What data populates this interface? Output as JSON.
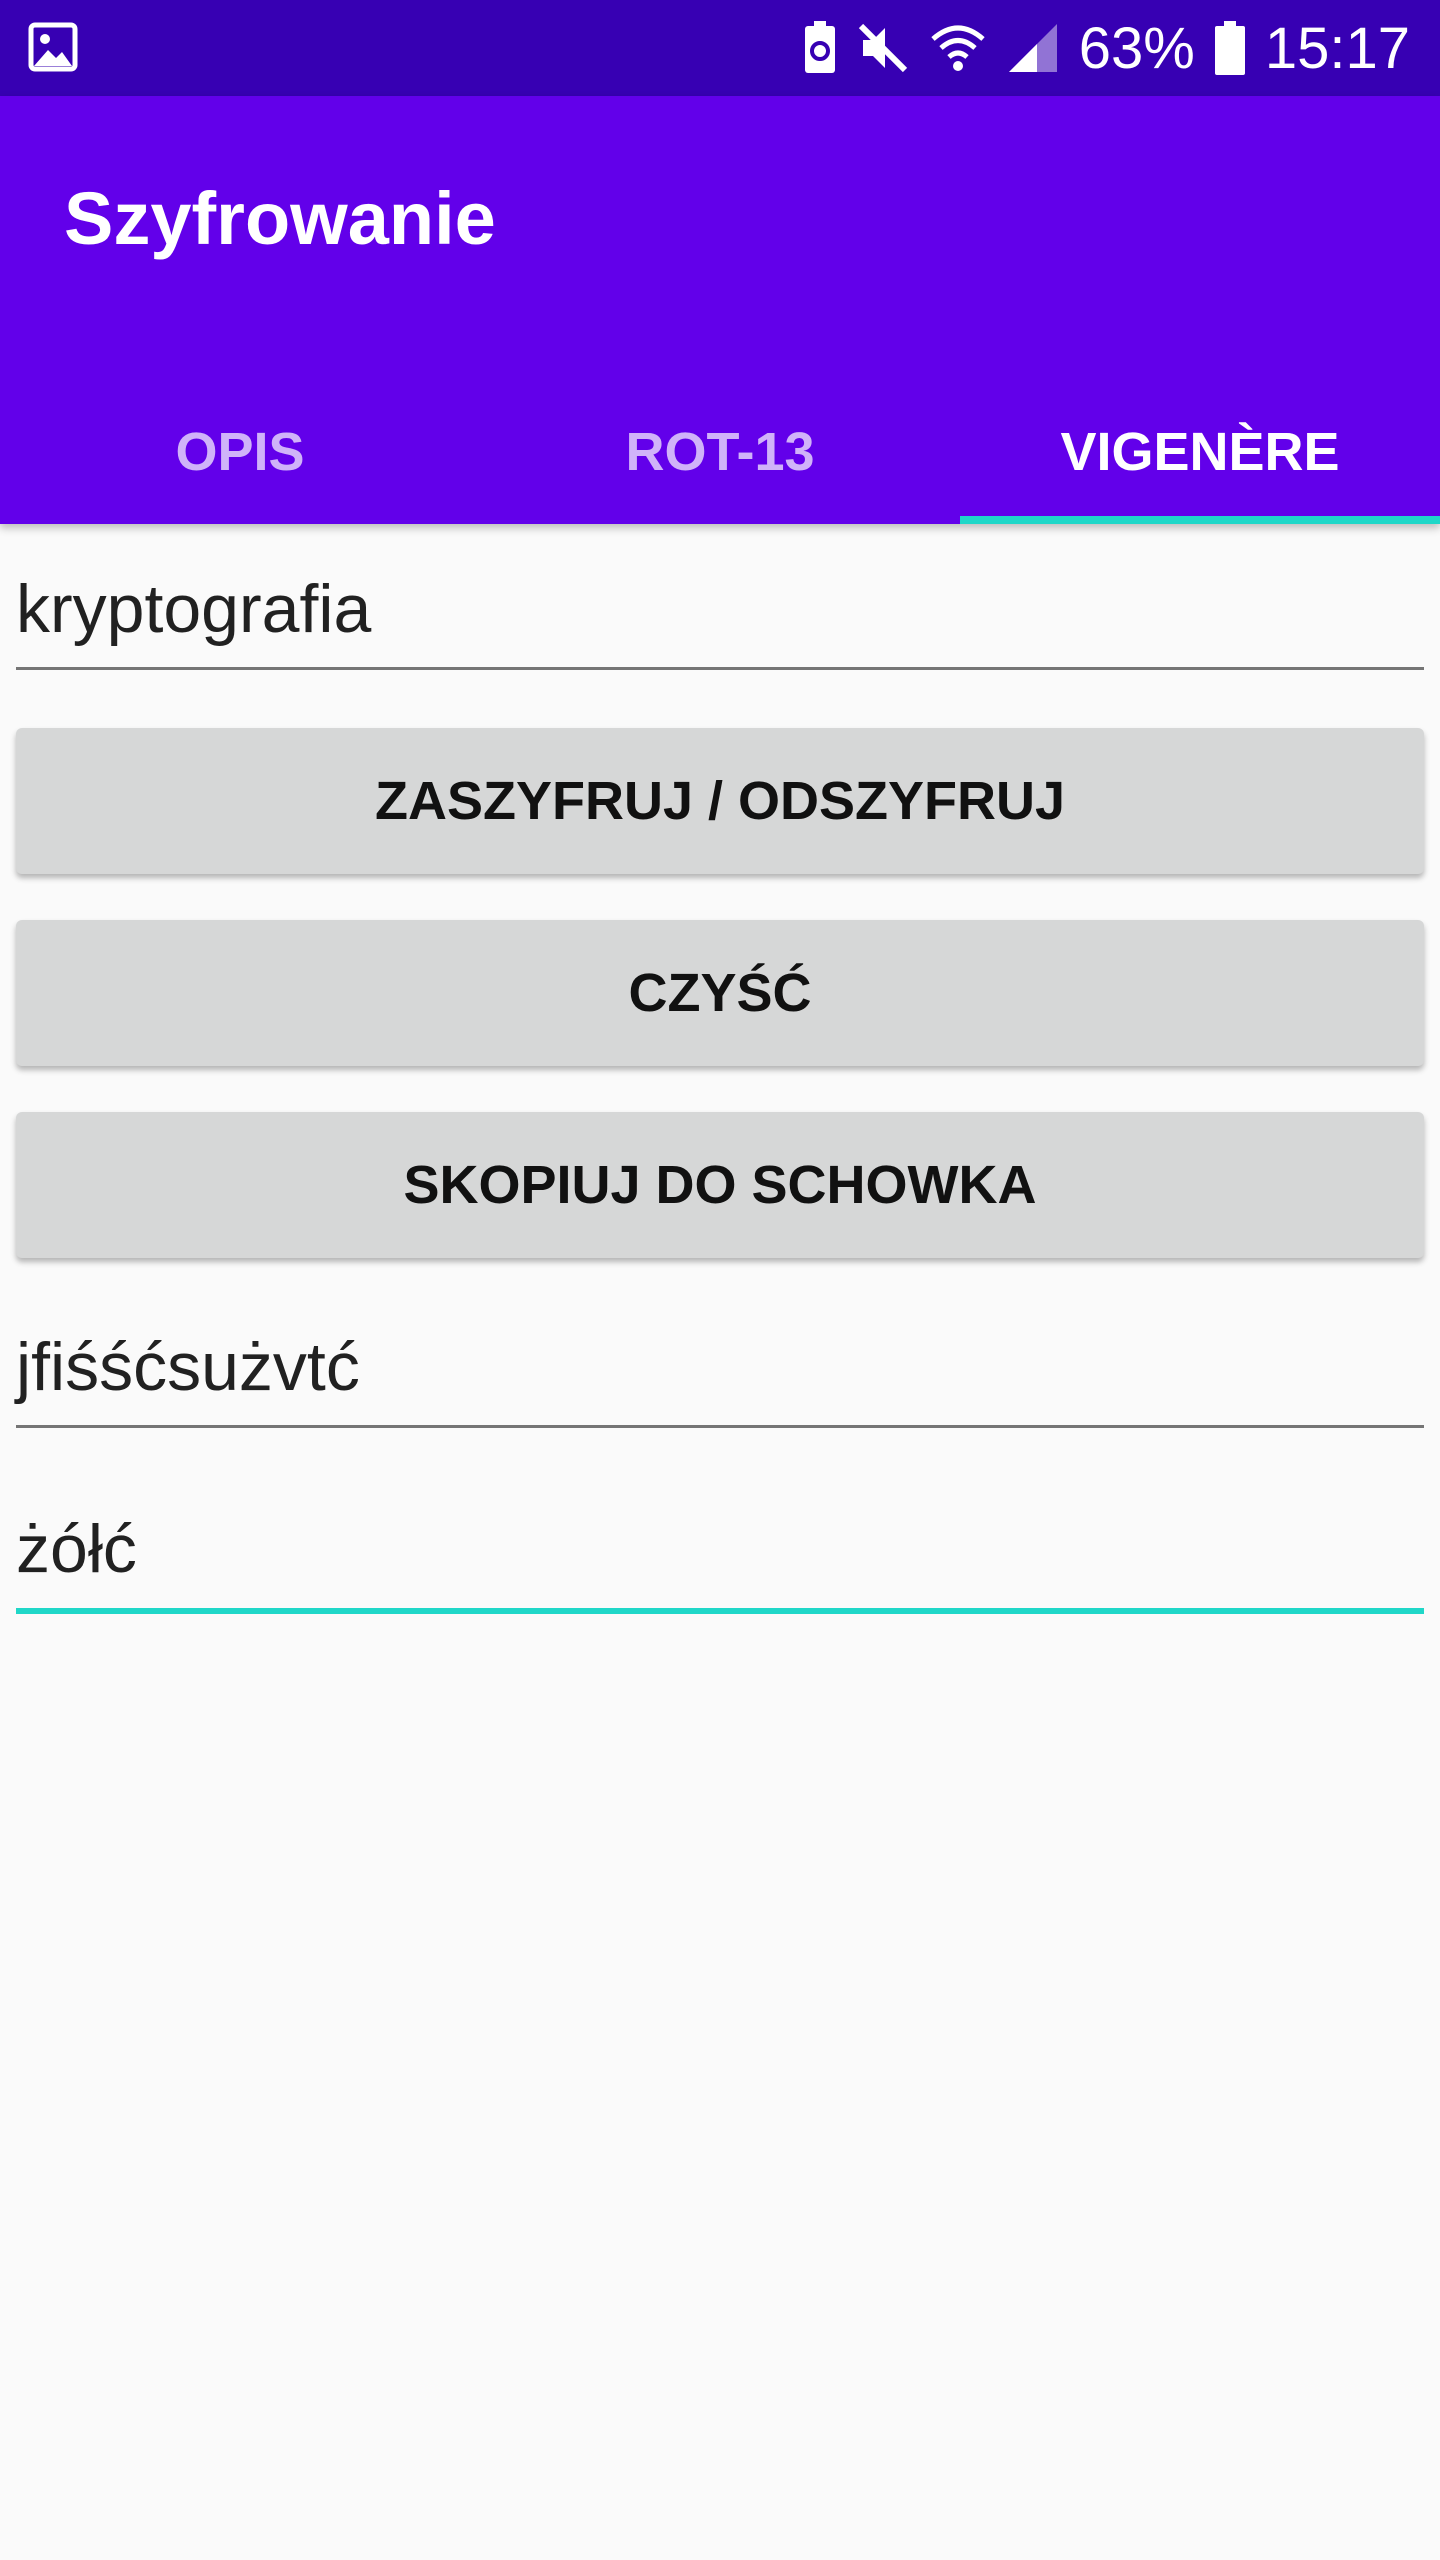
{
  "colors": {
    "status_bar": "#3700b3",
    "app_bar": "#6200ea",
    "accent": "#1fd7c8",
    "button_bg": "#d6d7d7",
    "background": "#fafafa"
  },
  "status_bar": {
    "battery_percent": "63%",
    "time": "15:17",
    "icons": [
      "gallery-icon",
      "battery-saver-icon",
      "mute-icon",
      "wifi-icon",
      "signal-icon",
      "battery-icon"
    ]
  },
  "app_bar": {
    "title": "Szyfrowanie"
  },
  "tabs": [
    {
      "label": "OPIS",
      "active": false
    },
    {
      "label": "ROT-13",
      "active": false
    },
    {
      "label": "VIGENÈRE",
      "active": true
    }
  ],
  "main": {
    "input_text": "kryptografia",
    "buttons": {
      "encrypt_decrypt": "ZASZYFRUJ / ODSZYFRUJ",
      "clear": "CZYŚĆ",
      "copy": "SKOPIUJ DO SCHOWKA"
    },
    "output_text": "jfiśśćsużvtć",
    "key_text": "żółć"
  }
}
